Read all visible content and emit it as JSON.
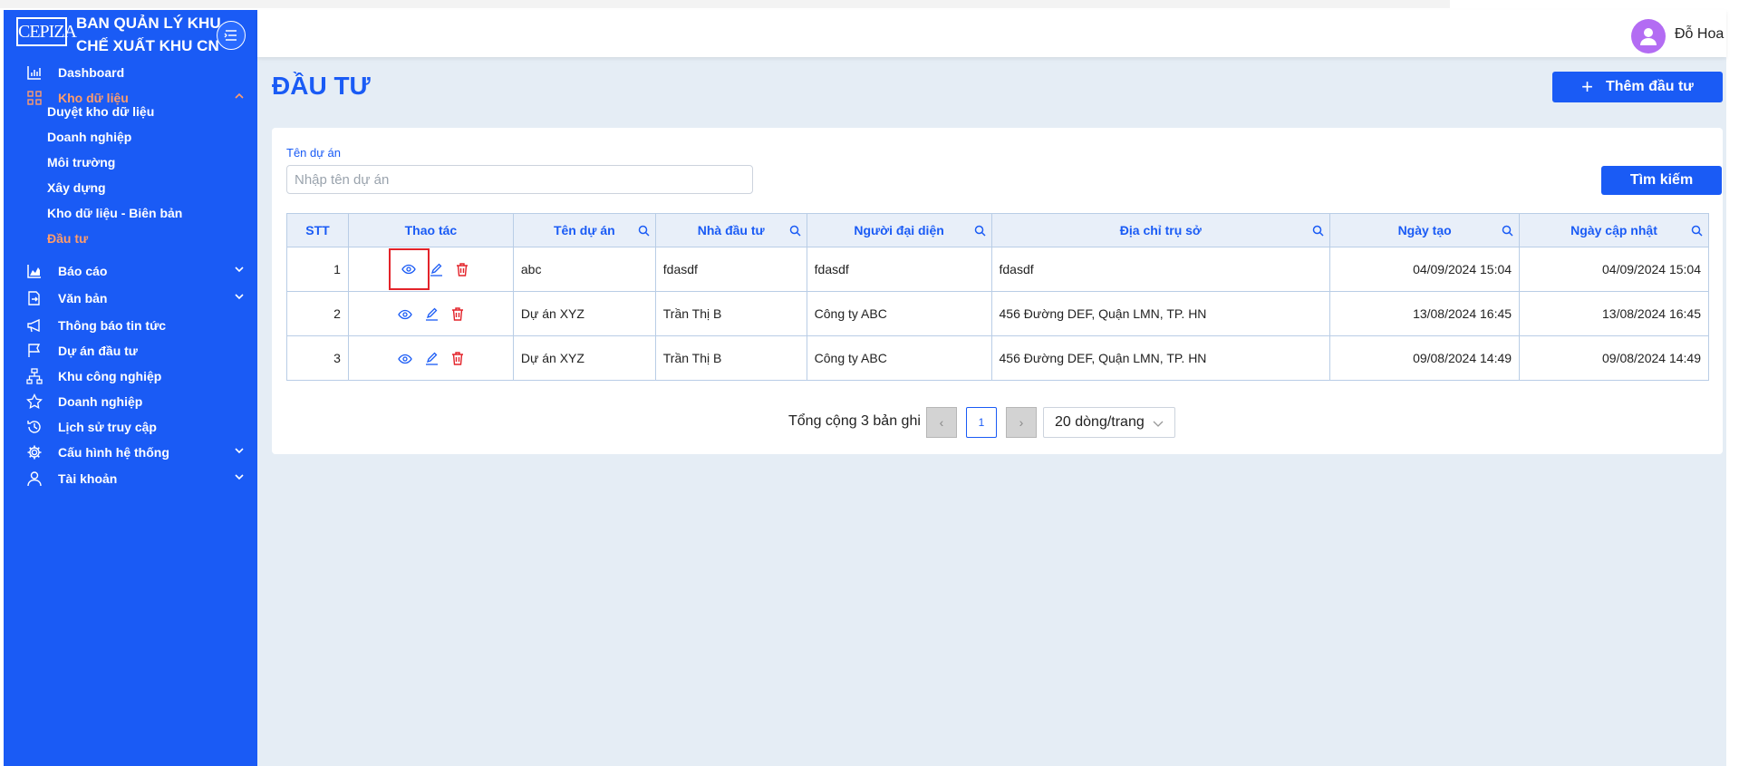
{
  "sidebar": {
    "brand_line1": "BAN QUẢN LÝ KHU",
    "brand_line2": "CHẾ XUẤT KHU CN",
    "logo_text": "CEPIZA",
    "menu": [
      {
        "label": "Dashboard",
        "icon": "bar-chart-icon"
      },
      {
        "label": "Kho dữ liệu",
        "icon": "grid-icon",
        "expanded": true,
        "active": true
      },
      {
        "label": "Báo cáo",
        "icon": "area-chart-icon"
      },
      {
        "label": "Văn bản",
        "icon": "document-transfer-icon"
      },
      {
        "label": "Thông báo tin tức",
        "icon": "megaphone-icon"
      },
      {
        "label": "Dự án đầu tư",
        "icon": "flag-icon"
      },
      {
        "label": "Khu công nghiệp",
        "icon": "org-chart-icon"
      },
      {
        "label": "Doanh nghiệp",
        "icon": "star-icon"
      },
      {
        "label": "Lịch sử truy cập",
        "icon": "history-icon"
      },
      {
        "label": "Cấu hình hệ thống",
        "icon": "gear-icon"
      },
      {
        "label": "Tài khoản",
        "icon": "user-icon"
      }
    ],
    "submenu": [
      {
        "label": "Duyệt kho dữ liệu"
      },
      {
        "label": "Doanh nghiệp"
      },
      {
        "label": "Môi trường"
      },
      {
        "label": "Xây dựng"
      },
      {
        "label": "Kho dữ liệu - Biên bản"
      },
      {
        "label": "Đầu tư",
        "active": true
      }
    ]
  },
  "header": {
    "username": "Đỗ Hoa"
  },
  "page": {
    "title": "ĐẦU TƯ",
    "add_label": "Thêm đầu tư"
  },
  "filter": {
    "label": "Tên dự án",
    "placeholder": "Nhập tên dự án",
    "value": "",
    "search_label": "Tìm kiếm"
  },
  "table": {
    "columns": [
      "STT",
      "Thao tác",
      "Tên dự án",
      "Nhà đầu tư",
      "Người đại diện",
      "Địa chỉ trụ sở",
      "Ngày tạo",
      "Ngày cập nhật"
    ],
    "rows": [
      {
        "stt": "1",
        "ten_du_an": "abc",
        "nha_dau_tu": "fdasdf",
        "nguoi_dai_dien": "fdasdf",
        "dia_chi": "fdasdf",
        "ngay_tao": "04/09/2024 15:04",
        "ngay_cap_nhat": "04/09/2024 15:04"
      },
      {
        "stt": "2",
        "ten_du_an": "Dự án XYZ",
        "nha_dau_tu": "Trần Thị B",
        "nguoi_dai_dien": "Công ty ABC",
        "dia_chi": "456 Đường DEF, Quận LMN, TP. HN",
        "ngay_tao": "13/08/2024 16:45",
        "ngay_cap_nhat": "13/08/2024 16:45"
      },
      {
        "stt": "3",
        "ten_du_an": "Dự án XYZ",
        "nha_dau_tu": "Trần Thị B",
        "nguoi_dai_dien": "Công ty ABC",
        "dia_chi": "456 Đường DEF, Quận LMN, TP. HN",
        "ngay_tao": "09/08/2024 14:49",
        "ngay_cap_nhat": "09/08/2024 14:49"
      }
    ]
  },
  "pagination": {
    "total_text": "Tổng cộng 3 bản ghi",
    "current_page": "1",
    "page_size": "20 dòng/trang"
  },
  "colors": {
    "primary": "#1a5bf5",
    "active_menu": "#ff9c6b",
    "delete": "#e3232a",
    "highlight": "#e3232a",
    "background": "#e5edf5"
  }
}
